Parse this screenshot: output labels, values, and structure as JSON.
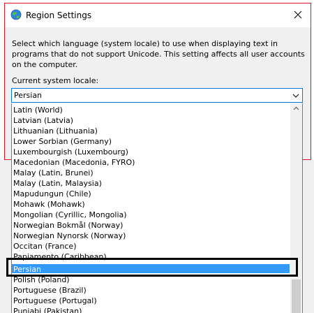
{
  "window": {
    "title": "Region Settings",
    "description": "Select which language (system locale) to use when displaying text in programs that do not support Unicode. This setting affects all user accounts on the computer.",
    "locale_label": "Current system locale:",
    "selected_locale": "Persian",
    "title_icon": "globe-icon",
    "close_icon": "close-icon"
  },
  "locale_list": {
    "items": [
      "Latin (World)",
      "Latvian (Latvia)",
      "Lithuanian (Lithuania)",
      "Lower Sorbian (Germany)",
      "Luxembourgish (Luxembourg)",
      "Macedonian (Macedonia, FYRO)",
      "Malay (Latin, Brunei)",
      "Malay (Latin, Malaysia)",
      "Mapudungun (Chile)",
      "Mohawk (Mohawk)",
      "Mongolian (Cyrillic, Mongolia)",
      "Norwegian Bokmål (Norway)",
      "Norwegian Nynorsk (Norway)",
      "Occitan (France)",
      "Papiamento (Caribbean)",
      "Persian",
      "Polish (Poland)",
      "Portuguese (Brazil)",
      "Portuguese (Portugal)",
      "Punjabi (Pakistan)"
    ],
    "selected_index": 15
  },
  "colors": {
    "selection": "#3399ff",
    "focus_border": "#0078d7",
    "window_border": "#e81123"
  }
}
